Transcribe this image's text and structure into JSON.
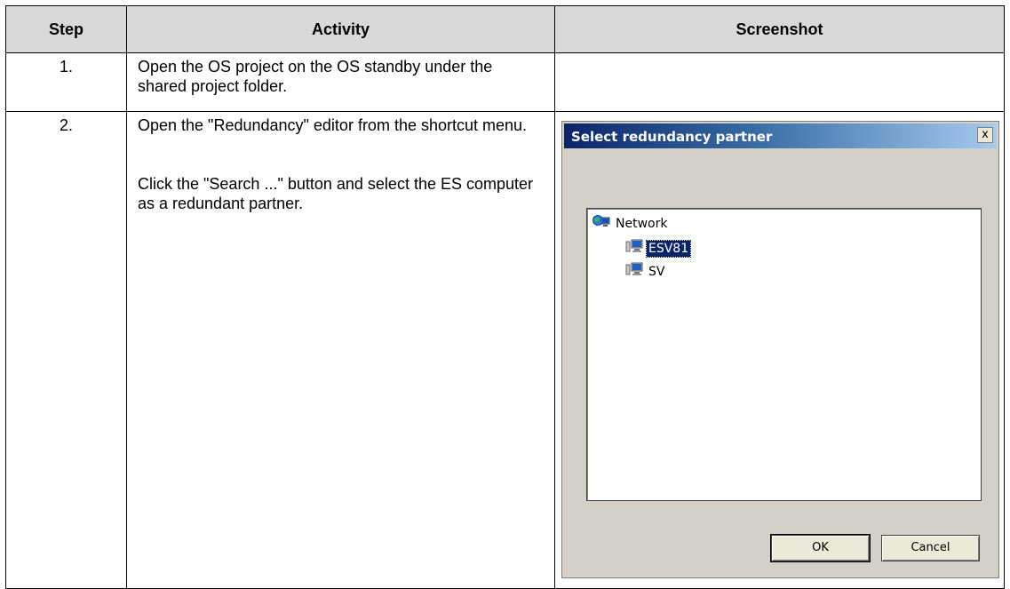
{
  "table": {
    "headers": [
      "Step",
      "Activity",
      "Screenshot"
    ],
    "rows": [
      {
        "step": "1.",
        "activity": [
          "Open the OS project on the OS standby under the shared project folder."
        ]
      },
      {
        "step": "2.",
        "activity": [
          "Open the \"Redundancy\" editor from the shortcut menu.",
          "Click the \"Search ...\" button and select the ES computer as a redundant partner."
        ]
      }
    ]
  },
  "dialog": {
    "title": "Select redundancy partner",
    "close_label": "x",
    "tree": {
      "root": {
        "label": "Network",
        "icon": "network-icon"
      },
      "children": [
        {
          "label": "ESV81",
          "icon": "computer-icon",
          "selected": true
        },
        {
          "label": "SV",
          "icon": "computer-icon",
          "selected": false
        }
      ]
    },
    "ok_label": "OK",
    "cancel_label": "Cancel"
  },
  "colors": {
    "header_bg": "#d9d9d9",
    "dialog_bg": "#d4d0c8",
    "titlebar": "#0a246a",
    "selection": "#0a246a"
  }
}
